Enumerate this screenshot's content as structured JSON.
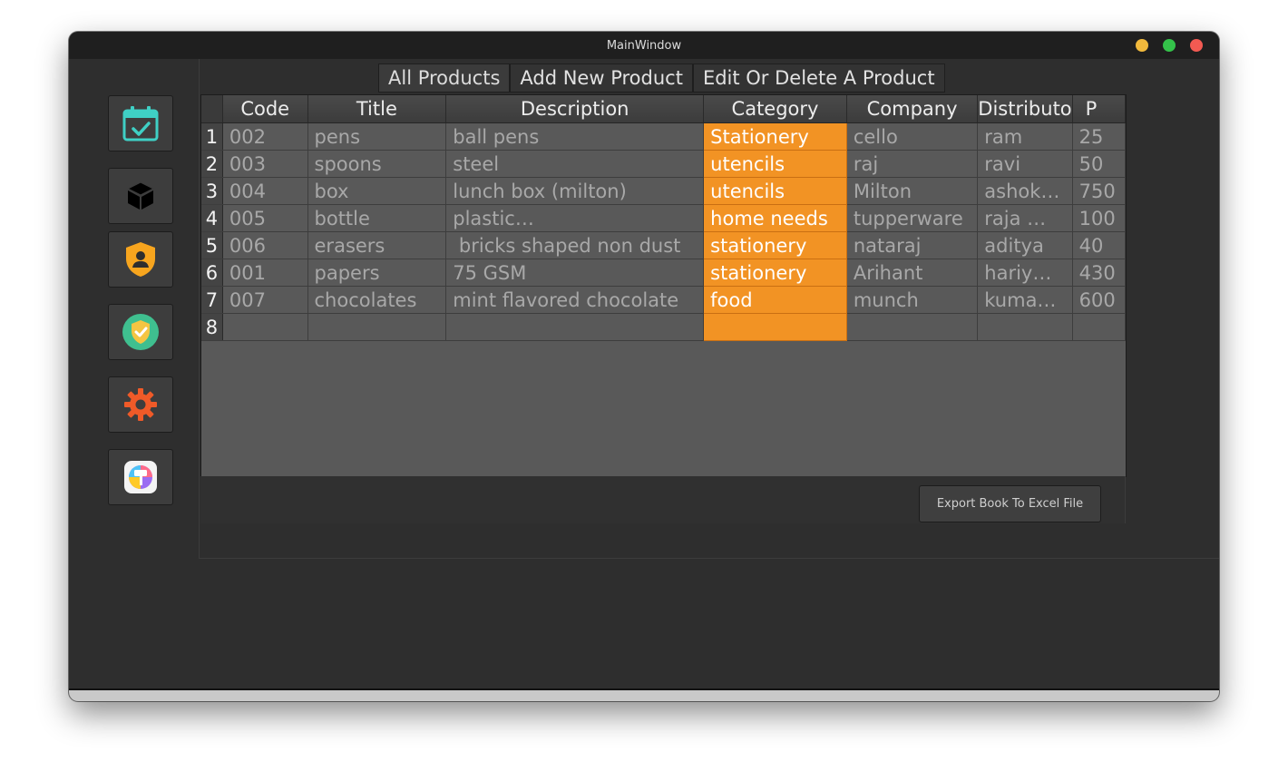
{
  "window": {
    "title": "MainWindow"
  },
  "sidebar": {
    "items": [
      {
        "name": "calendar-check-icon"
      },
      {
        "name": "cube-icon"
      },
      {
        "name": "user-shield-icon"
      },
      {
        "name": "verified-shield-icon"
      },
      {
        "name": "gear-icon"
      },
      {
        "name": "paint-roller-icon"
      }
    ]
  },
  "tabs": [
    {
      "label": "All Products",
      "active": true
    },
    {
      "label": "Add New Product",
      "active": false
    },
    {
      "label": "Edit Or Delete A Product",
      "active": false
    }
  ],
  "table": {
    "columns": [
      "Code",
      "Title",
      "Description",
      "Category",
      "Company",
      "Distributo",
      "P"
    ],
    "rows": [
      {
        "num": "1",
        "cells": [
          "002",
          "pens",
          "ball pens",
          "Stationery",
          "cello",
          "ram",
          "25"
        ]
      },
      {
        "num": "2",
        "cells": [
          "003",
          "spoons",
          "steel",
          "utencils",
          "raj",
          "ravi",
          "50"
        ]
      },
      {
        "num": "3",
        "cells": [
          "004",
          "box",
          "lunch box (milton)",
          "utencils",
          "Milton",
          "ashok…",
          "750"
        ]
      },
      {
        "num": "4",
        "cells": [
          "005",
          "bottle",
          "plastic…",
          "home needs",
          "tupperware",
          "raja …",
          "100"
        ]
      },
      {
        "num": "5",
        "cells": [
          "006",
          "erasers",
          " bricks shaped non dust",
          "stationery",
          "nataraj",
          "aditya",
          "40"
        ]
      },
      {
        "num": "6",
        "cells": [
          "001",
          "papers",
          "75 GSM",
          "stationery",
          "Arihant",
          "hariy…",
          "430"
        ]
      },
      {
        "num": "7",
        "cells": [
          "007",
          "chocolates",
          "mint flavored chocolate",
          "food",
          "munch",
          "kuma…",
          "600"
        ]
      },
      {
        "num": "8",
        "cells": [
          "",
          "",
          "",
          "",
          "",
          "",
          ""
        ]
      }
    ]
  },
  "export_button": {
    "label": "Export Book To Excel File"
  },
  "colors": {
    "accent": "#f29324",
    "window_bg": "#2e2e2e",
    "table_bg": "#595959",
    "titlebar": "#1f1f1f"
  }
}
